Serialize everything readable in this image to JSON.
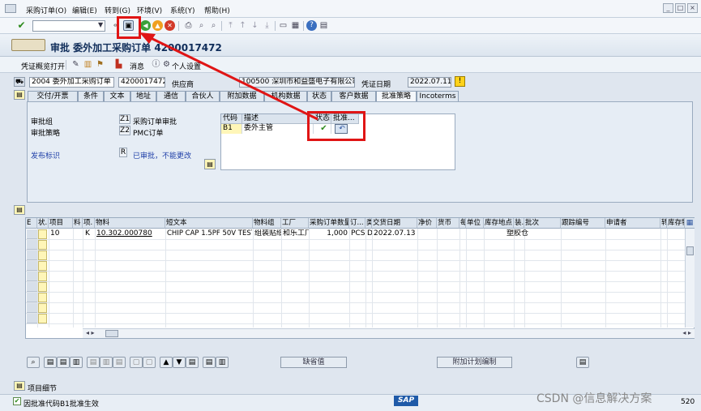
{
  "menu": [
    "采购订单(O)",
    "编辑(E)",
    "转到(G)",
    "环境(V)",
    "系统(Y)",
    "帮助(H)"
  ],
  "title": "审批 委外加工采购订单 4200017472",
  "app_toolbar": {
    "doc_overview": "凭证概览打开",
    "messages": "消息",
    "personal_settings": "个人设置"
  },
  "header": {
    "doc_type": "2004 委外加工采购订单",
    "po_number": "4200017472",
    "supplier_label": "供应商",
    "supplier_value": "100500 深圳市和益盛电子有限公司",
    "doc_date_label": "凭证日期",
    "doc_date_value": "2022.07.11"
  },
  "tabs": [
    "交付/开票",
    "条件",
    "文本",
    "地址",
    "通信",
    "合伙人",
    "附加数据",
    "机构数据",
    "状态",
    "客户数据",
    "批准策略",
    "Incoterms"
  ],
  "release": {
    "group_label": "审批组",
    "group_code": "Z1",
    "group_text": "采购订单审批",
    "strategy_label": "审批策略",
    "strategy_code": "Z2",
    "strategy_text": "PMC订单",
    "indicator_label": "发布标识",
    "indicator_code": "R",
    "indicator_text": "已审批，不能更改"
  },
  "approver_table": {
    "headers": [
      "代码",
      "描述",
      "状态",
      "批准..."
    ],
    "rows": [
      {
        "code": "B1",
        "desc": "委外主管"
      }
    ]
  },
  "grid": {
    "headers": [
      "E",
      "状.",
      "项目",
      "料",
      "项.",
      "物料",
      "短文本",
      "物料组",
      "工厂",
      "采购订单数量",
      "订...",
      "类",
      "交货日期",
      "净价",
      "货币",
      "每",
      "单位",
      "库存地点",
      "装.",
      "批次",
      "跟踪编号",
      "申请者",
      "转",
      "库存特"
    ],
    "row": {
      "item": "10",
      "acct": "K",
      "material": "10.302.000780",
      "short_text": "CHIP CAP 1.5PF 50V TEST ...",
      "mat_group": "组装贴纸",
      "plant": "和乐工厂",
      "qty": "1,000",
      "unit": "PCS",
      "cat": "D",
      "delivery": "2022.07.13",
      "sloc": "塑胶仓"
    }
  },
  "bottom": {
    "default_values": "缺省值",
    "addl_planning": "附加计划编制",
    "item_detail": "项目细节"
  },
  "status": {
    "message": "因批准代码B1批准生效",
    "sap": "SAP",
    "watermark": "CSDN @信息解决方案",
    "client": "520"
  },
  "colors": {
    "accent": "#102d5a",
    "red": "#e01515"
  }
}
